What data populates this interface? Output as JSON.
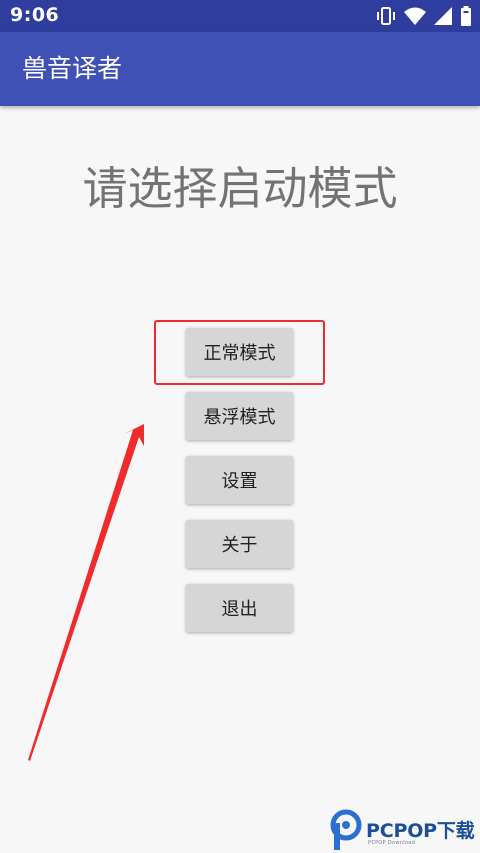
{
  "status_bar": {
    "time": "9:06",
    "icons": [
      "vibrate-icon",
      "wifi-icon",
      "signal-icon",
      "battery-icon"
    ]
  },
  "app_bar": {
    "title": "兽音译者"
  },
  "main": {
    "heading": "请选择启动模式",
    "buttons": [
      {
        "label": "正常模式"
      },
      {
        "label": "悬浮模式"
      },
      {
        "label": "设置"
      },
      {
        "label": "关于"
      },
      {
        "label": "退出"
      }
    ]
  },
  "watermark": {
    "text": "PCPOP下载",
    "subtext": "PCPOP Download"
  },
  "colors": {
    "status_bar": "#2f3e9e",
    "app_bar": "#3f51b5",
    "background": "#f7f7f7",
    "button": "#d6d6d6",
    "annotation": "#ef2b2b"
  }
}
